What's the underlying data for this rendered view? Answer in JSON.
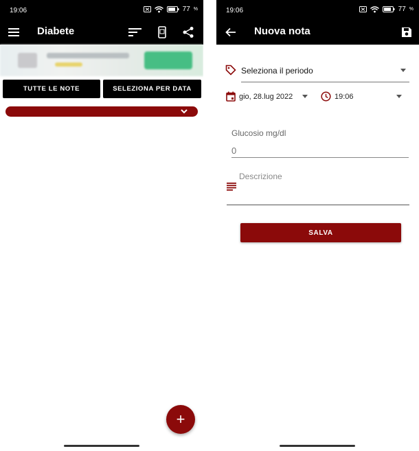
{
  "left": {
    "status": {
      "time": "19:06",
      "battery": "77"
    },
    "appbar": {
      "title": "Diabete"
    },
    "buttons": {
      "all_notes": "TUTTE LE NOTE",
      "select_by_date": "SELEZIONA PER DATA"
    },
    "fab": {
      "label": "+"
    }
  },
  "right": {
    "status": {
      "time": "19:06",
      "battery": "77"
    },
    "appbar": {
      "title": "Nuova nota"
    },
    "period": {
      "value": "Seleziona il periodo"
    },
    "date": {
      "value": "gio, 28.lug 2022"
    },
    "time": {
      "value": "19:06"
    },
    "glucose": {
      "label": "Glucosio mg/dl",
      "placeholder": "0"
    },
    "description": {
      "placeholder": "Descrizione"
    },
    "save": {
      "label": "SALVA"
    }
  },
  "colors": {
    "accent": "#8B0A0A",
    "appbar": "#000000"
  }
}
